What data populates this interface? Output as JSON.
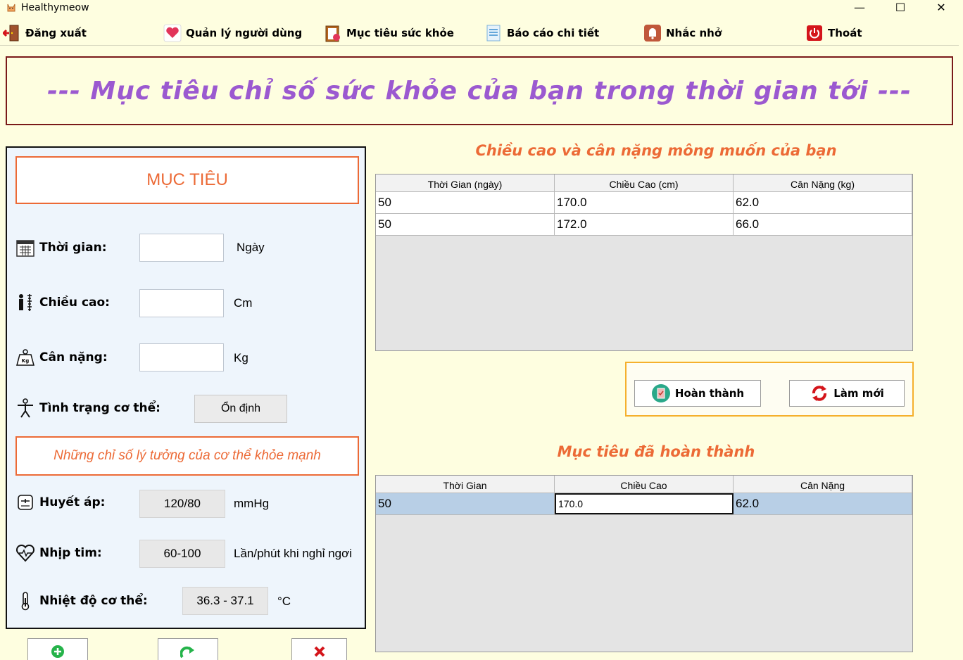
{
  "window": {
    "title": "Healthymeow",
    "minimize_glyph": "—",
    "maximize_glyph": "☐",
    "close_glyph": "✕"
  },
  "menu": {
    "items": [
      {
        "label": "Đăng xuất",
        "icon": "logout-door-icon"
      },
      {
        "label": "Quản lý người dùng",
        "icon": "heart-icon"
      },
      {
        "label": "Mục tiêu sức khỏe",
        "icon": "clipboard-icon"
      },
      {
        "label": "Báo cáo chi tiết",
        "icon": "report-icon"
      },
      {
        "label": "Nhắc nhở",
        "icon": "bell-icon"
      },
      {
        "label": "Thoát",
        "icon": "power-icon"
      }
    ]
  },
  "banner": {
    "text": "--- Mục tiêu chỉ số sức khỏe của bạn trong thời gian tới ---"
  },
  "goal_form": {
    "heading": "MỤC TIÊU",
    "time": {
      "label": "Thời gian:",
      "value": "",
      "unit": "Ngày"
    },
    "height": {
      "label": "Chiều cao:",
      "value": "",
      "unit": "Cm"
    },
    "weight": {
      "label": "Cân nặng:",
      "value": "",
      "unit": "Kg"
    },
    "body_status": {
      "label": "Tình trạng cơ thể:",
      "value": "Ổn định"
    }
  },
  "ideal": {
    "heading": "Những chỉ số lý tưởng của cơ thể khỏe mạnh",
    "blood_pressure": {
      "label": "Huyết áp:",
      "value": "120/80",
      "unit": "mmHg"
    },
    "heart_rate": {
      "label": "Nhịp tim:",
      "value": "60-100",
      "unit": "Lần/phút khi nghỉ ngơi"
    },
    "body_temp": {
      "label": "Nhiệt độ cơ thể:",
      "value": "36.3 - 37.1",
      "unit": "°C"
    }
  },
  "targets_section": {
    "heading": "Chiều cao và cân nặng mông muốn của bạn",
    "columns": [
      "Thời Gian (ngày)",
      "Chiều Cao (cm)",
      "Cân Nặng (kg)"
    ],
    "rows": [
      [
        "50",
        "170.0",
        "62.0"
      ],
      [
        "50",
        "172.0",
        "66.0"
      ]
    ]
  },
  "actions": {
    "complete_label": "Hoàn thành",
    "refresh_label": "Làm mới"
  },
  "completed_section": {
    "heading": "Mục tiêu đã hoàn thành",
    "columns": [
      "Thời Gian",
      "Chiều Cao",
      "Cân Nặng"
    ],
    "rows": [
      [
        "50",
        "170.0",
        "62.0"
      ]
    ]
  },
  "colors": {
    "accent": "#ec6a36",
    "banner_text": "#9b59d0",
    "selected_row": "#b8cfe6",
    "action_border": "#f5b02d"
  }
}
